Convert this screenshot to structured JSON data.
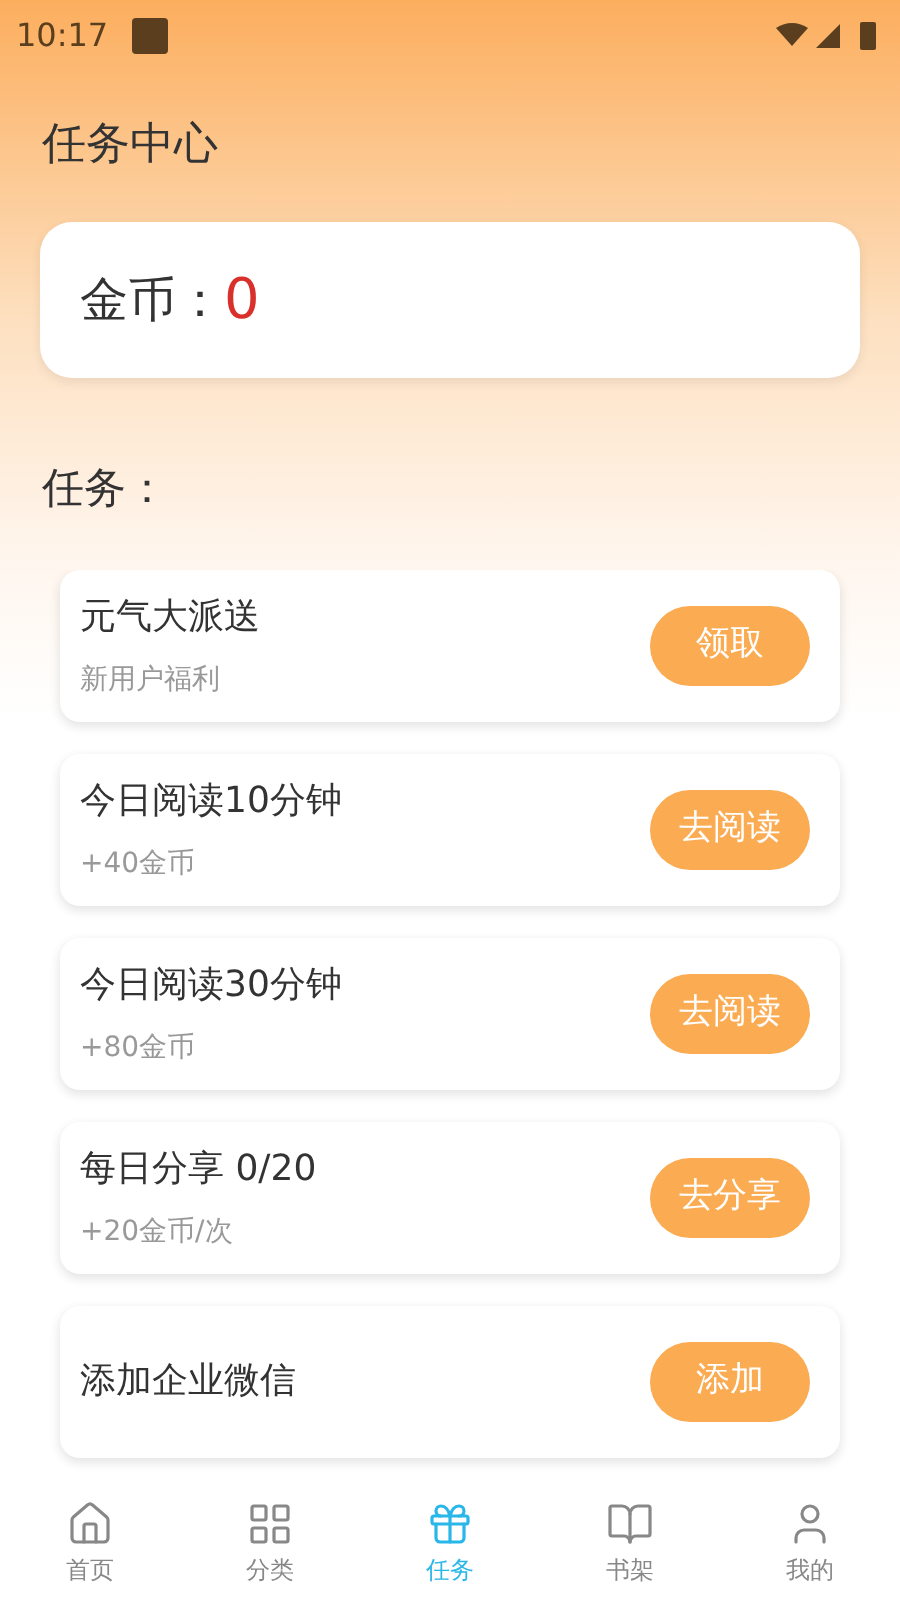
{
  "status_bar": {
    "time": "10:17"
  },
  "title": "任务中心",
  "coins": {
    "label": "金币：",
    "value": "0"
  },
  "tasks_heading": "任务：",
  "tasks": [
    {
      "title": "元气大派送",
      "subtitle": "新用户福利",
      "button": "领取"
    },
    {
      "title": "今日阅读10分钟",
      "subtitle": "+40金币",
      "button": "去阅读"
    },
    {
      "title": "今日阅读30分钟",
      "subtitle": "+80金币",
      "button": "去阅读"
    },
    {
      "title": "每日分享 0/20",
      "subtitle": "+20金币/次",
      "button": "去分享"
    },
    {
      "title": "添加企业微信",
      "button": "添加"
    }
  ],
  "nav": [
    {
      "kind": "home",
      "label": "首页",
      "selected": false
    },
    {
      "kind": "grid",
      "label": "分类",
      "selected": false
    },
    {
      "kind": "gift",
      "label": "任务",
      "selected": true
    },
    {
      "kind": "book",
      "label": "书架",
      "selected": false
    },
    {
      "kind": "user",
      "label": "我的",
      "selected": false
    }
  ]
}
